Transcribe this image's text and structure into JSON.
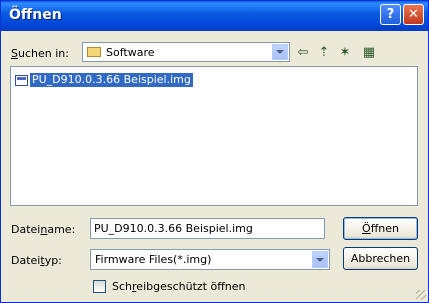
{
  "window": {
    "title": "Öffnen",
    "help_glyph": "?",
    "close_glyph": "✕"
  },
  "lookin": {
    "label_pre": "",
    "label_u": "S",
    "label_post": "uchen in:",
    "folder": "Software"
  },
  "toolbar": {
    "back": "⇦",
    "up": "⇡",
    "new_folder": "✶",
    "view": "▦"
  },
  "files": [
    {
      "name": "PU_D910.0.3.66 Beispiel.img",
      "selected": true
    }
  ],
  "filename": {
    "label_pre": "Datei",
    "label_u": "n",
    "label_post": "ame:",
    "value": "PU_D910.0.3.66 Beispiel.img"
  },
  "filetype": {
    "label_pre": "Datei",
    "label_u": "t",
    "label_post": "yp:",
    "value": "Firmware Files(*.img)"
  },
  "readonly": {
    "label_pre": "Sch",
    "label_u": "r",
    "label_post": "eibgeschützt öffnen",
    "checked": false
  },
  "buttons": {
    "open_u": "Ö",
    "open_rest": "ffnen",
    "cancel": "Abbrechen"
  }
}
